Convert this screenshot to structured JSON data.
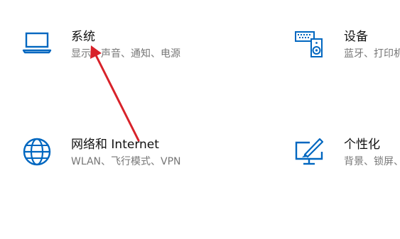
{
  "accent_color": "#0067c0",
  "annotation_color": "#d8222a",
  "tiles": [
    {
      "title": "系统",
      "desc": "显示、声音、通知、电源",
      "icon": "laptop-icon"
    },
    {
      "title": "设备",
      "desc": "蓝牙、打印机、鼠标",
      "icon": "keyboard-speaker-icon"
    },
    {
      "title": "网络和 Internet",
      "desc": "WLAN、飞行模式、VPN",
      "icon": "globe-icon"
    },
    {
      "title": "个性化",
      "desc": "背景、锁屏、颜色",
      "icon": "paint-monitor-icon"
    }
  ]
}
